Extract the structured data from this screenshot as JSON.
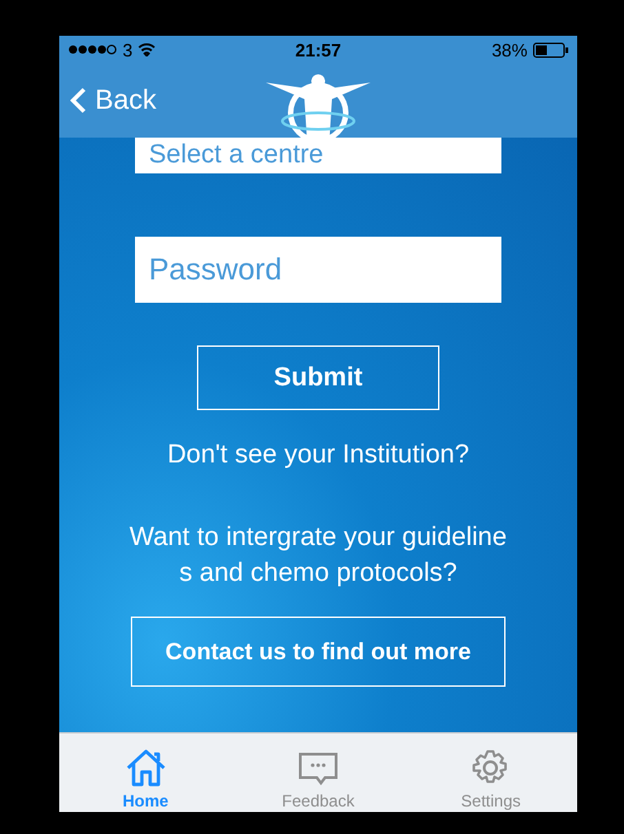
{
  "status_bar": {
    "carrier": "3",
    "time": "21:57",
    "battery": "38%"
  },
  "nav": {
    "back": "Back"
  },
  "form": {
    "centre": {
      "placeholder": "Select a centre"
    },
    "password": {
      "placeholder": "Password"
    },
    "submit": "Submit",
    "institution_link": "Don't see your Institution?",
    "integrate_lines": [
      "Want to intergrate your guideline",
      "s and chemo protocols?"
    ],
    "contact_button": "Contact us to find out more"
  },
  "tabs": [
    {
      "label": "Home",
      "kind": "home",
      "selected": true
    },
    {
      "label": "Feedback",
      "kind": "feedback",
      "selected": false
    },
    {
      "label": "Settings",
      "kind": "settings",
      "selected": false
    }
  ]
}
